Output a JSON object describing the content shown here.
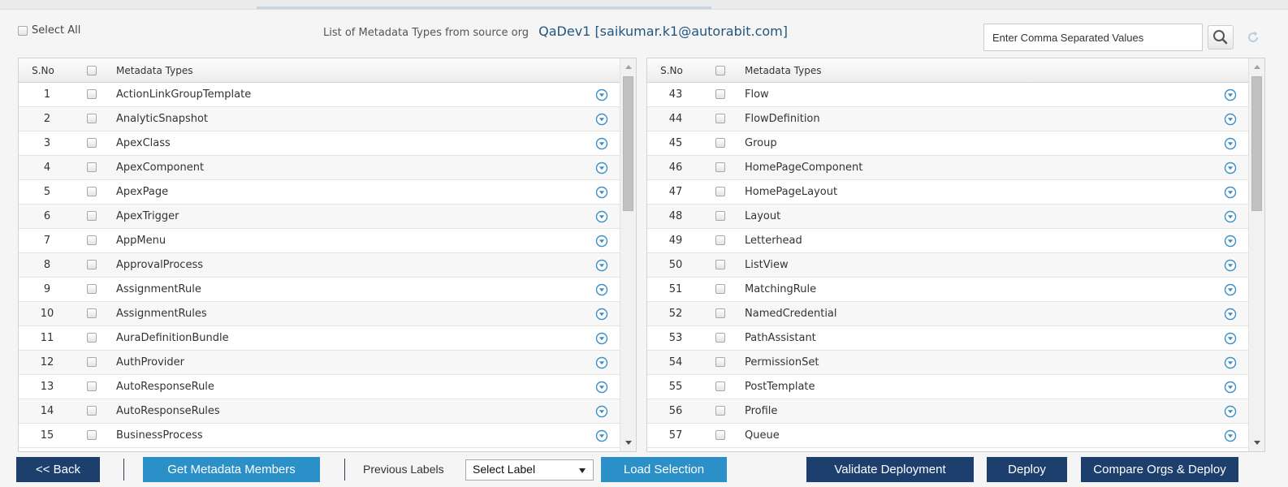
{
  "header": {
    "select_all_label": "Select All",
    "heading_text": "List of Metadata Types from source org",
    "org_label": "QaDev1 [saikumar.k1@autorabit.com]",
    "search_placeholder": "Enter Comma Separated Values",
    "search_icon": "search-icon",
    "refresh_icon": "refresh-icon"
  },
  "columns": {
    "sno": "S.No",
    "type": "Metadata Types"
  },
  "left_table": {
    "rows": [
      {
        "sno": "1",
        "type": "ActionLinkGroupTemplate"
      },
      {
        "sno": "2",
        "type": "AnalyticSnapshot"
      },
      {
        "sno": "3",
        "type": "ApexClass"
      },
      {
        "sno": "4",
        "type": "ApexComponent"
      },
      {
        "sno": "5",
        "type": "ApexPage"
      },
      {
        "sno": "6",
        "type": "ApexTrigger"
      },
      {
        "sno": "7",
        "type": "AppMenu"
      },
      {
        "sno": "8",
        "type": "ApprovalProcess"
      },
      {
        "sno": "9",
        "type": "AssignmentRule"
      },
      {
        "sno": "10",
        "type": "AssignmentRules"
      },
      {
        "sno": "11",
        "type": "AuraDefinitionBundle"
      },
      {
        "sno": "12",
        "type": "AuthProvider"
      },
      {
        "sno": "13",
        "type": "AutoResponseRule"
      },
      {
        "sno": "14",
        "type": "AutoResponseRules"
      },
      {
        "sno": "15",
        "type": "BusinessProcess"
      }
    ]
  },
  "right_table": {
    "rows": [
      {
        "sno": "43",
        "type": "Flow"
      },
      {
        "sno": "44",
        "type": "FlowDefinition"
      },
      {
        "sno": "45",
        "type": "Group"
      },
      {
        "sno": "46",
        "type": "HomePageComponent"
      },
      {
        "sno": "47",
        "type": "HomePageLayout"
      },
      {
        "sno": "48",
        "type": "Layout"
      },
      {
        "sno": "49",
        "type": "Letterhead"
      },
      {
        "sno": "50",
        "type": "ListView"
      },
      {
        "sno": "51",
        "type": "MatchingRule"
      },
      {
        "sno": "52",
        "type": "NamedCredential"
      },
      {
        "sno": "53",
        "type": "PathAssistant"
      },
      {
        "sno": "54",
        "type": "PermissionSet"
      },
      {
        "sno": "55",
        "type": "PostTemplate"
      },
      {
        "sno": "56",
        "type": "Profile"
      },
      {
        "sno": "57",
        "type": "Queue"
      }
    ]
  },
  "footer": {
    "back_label": "<< Back",
    "get_members_label": "Get Metadata Members",
    "previous_labels_text": "Previous Labels",
    "select_label_value": "Select Label",
    "load_selection_label": "Load Selection",
    "validate_label": "Validate Deployment",
    "deploy_label": "Deploy",
    "compare_label": "Compare Orgs & Deploy"
  },
  "colors": {
    "primary_dark": "#1d3f6e",
    "primary_light": "#2b90c8",
    "org_text": "#21577f",
    "expand_icon": "#3a8fc7"
  }
}
